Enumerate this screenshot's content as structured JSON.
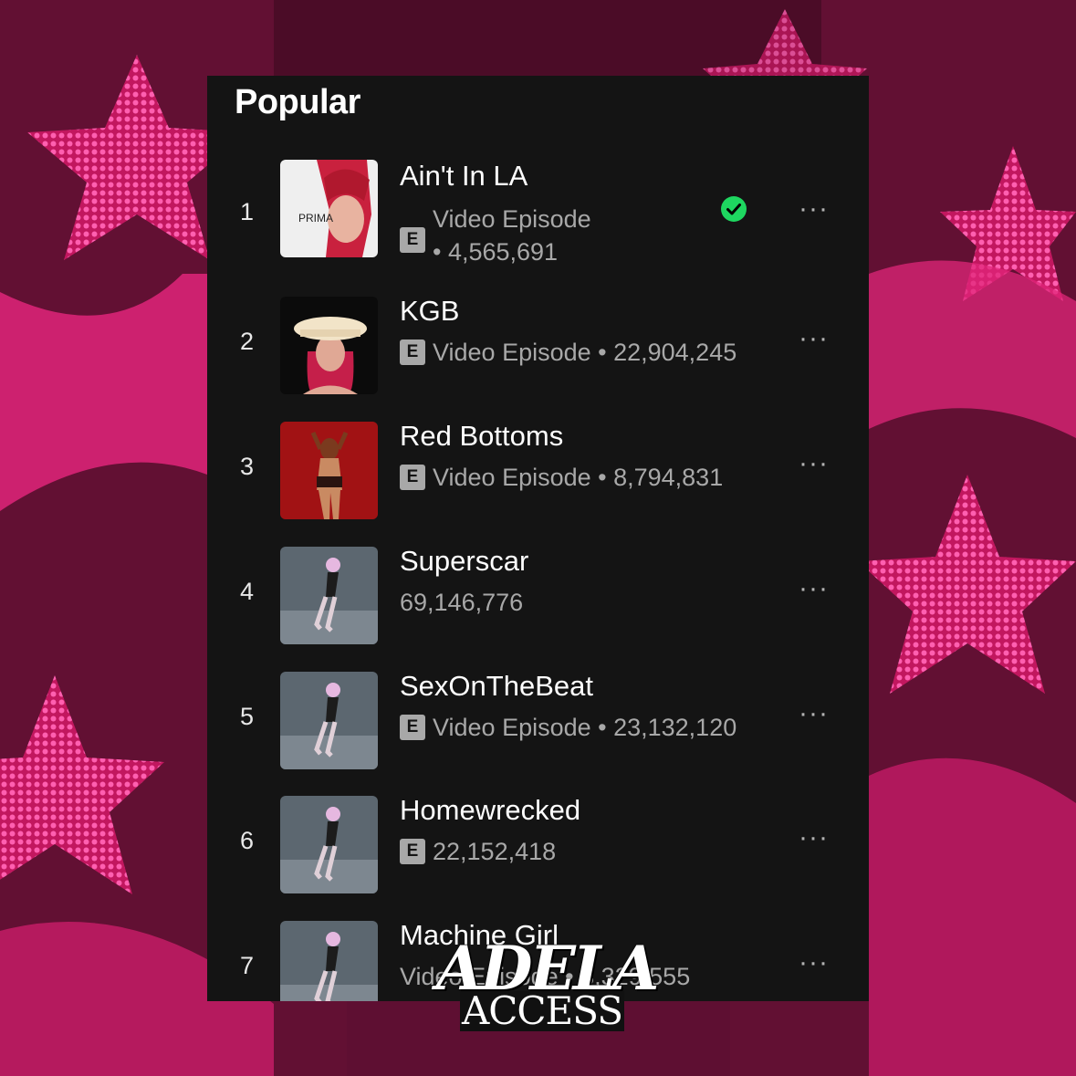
{
  "section_title": "Popular",
  "badge_explicit": "E",
  "more_glyph": "···",
  "rows": [
    {
      "rank": "1",
      "title": "Ain't In LA",
      "meta_line1": "Video Episode",
      "meta_line2": "• 4,565,691",
      "explicit": true,
      "downloaded": true
    },
    {
      "rank": "2",
      "title": "KGB",
      "meta": "Video Episode • 22,904,245",
      "explicit": true
    },
    {
      "rank": "3",
      "title": "Red Bottoms",
      "meta": "Video Episode • 8,794,831",
      "explicit": true
    },
    {
      "rank": "4",
      "title": "Superscar",
      "meta": "69,146,776",
      "explicit": false
    },
    {
      "rank": "5",
      "title": "SexOnTheBeat",
      "meta": "Video Episode • 23,132,120",
      "explicit": true
    },
    {
      "rank": "6",
      "title": "Homewrecked",
      "meta": "22,152,418",
      "explicit": true
    },
    {
      "rank": "7",
      "title": "Machine Girl",
      "meta": "Video Episode • 8,329,555",
      "explicit": false
    }
  ],
  "cover_1_text": "PRIMA",
  "watermark": {
    "top": "ADELA",
    "bottom": "ACCESS"
  },
  "colors": {
    "panel": "#141414",
    "accent_green": "#1ed760",
    "background_pink": "#e0257a",
    "background_dark": "#4a0c26"
  }
}
